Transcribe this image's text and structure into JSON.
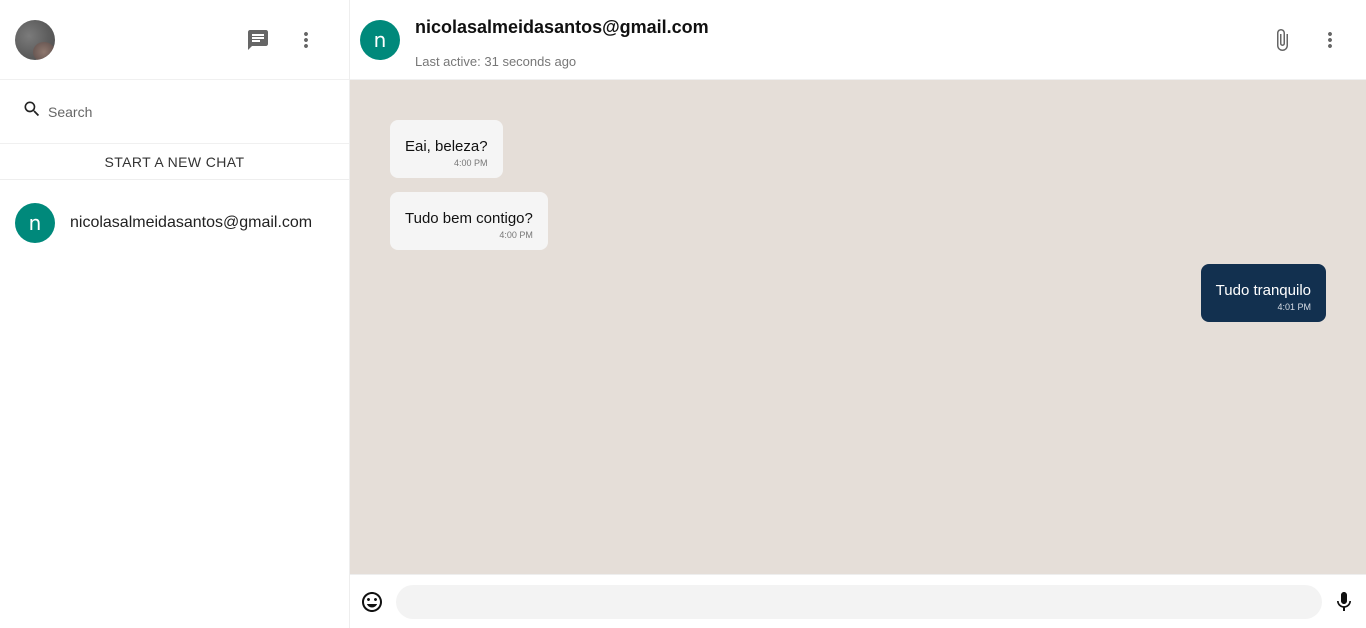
{
  "sidebar": {
    "search_placeholder": "Search",
    "new_chat_label": "START A NEW CHAT",
    "chats": [
      {
        "initial": "n",
        "name": "nicolasalmeidasantos@gmail.com"
      }
    ]
  },
  "conversation": {
    "initial": "n",
    "title": "nicolasalmeidasantos@gmail.com",
    "status": "Last active: 31 seconds ago",
    "messages": [
      {
        "direction": "in",
        "text": "Eai, beleza?",
        "time": "4:00 PM"
      },
      {
        "direction": "in",
        "text": "Tudo bem contigo?",
        "time": "4:00 PM"
      },
      {
        "direction": "out",
        "text": "Tudo tranquilo",
        "time": "4:01 PM"
      }
    ],
    "input_value": ""
  },
  "icons": {
    "header_left": [
      "profile-avatar",
      "chat-icon",
      "more-vert-icon"
    ],
    "search": "search-icon",
    "header_right": [
      "attach-icon",
      "more-vert-icon"
    ],
    "footer": [
      "emoji-icon",
      "mic-icon"
    ]
  },
  "colors": {
    "accent_avatar": "#00897b",
    "chat_background": "#e5ded8",
    "outgoing_bubble": "#12304f",
    "incoming_bubble": "#f5f5f5"
  }
}
